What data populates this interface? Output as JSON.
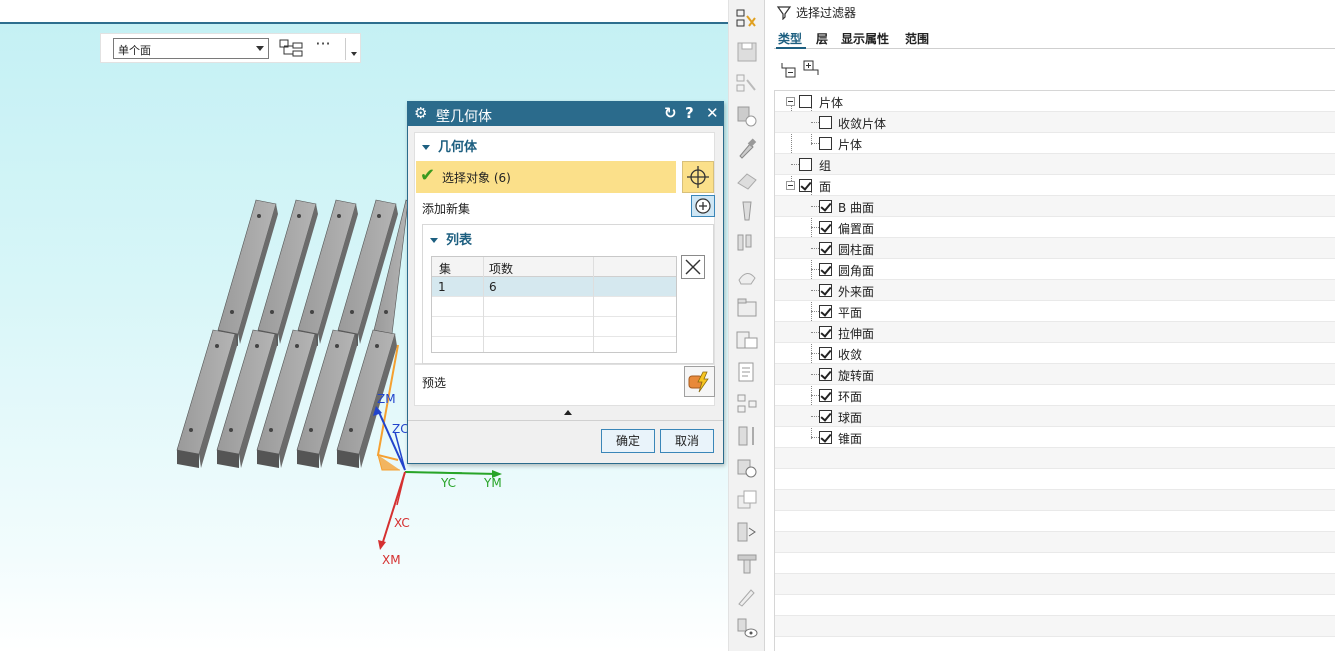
{
  "viewport": {
    "selection_filter_value": "单个面",
    "more_label": "···",
    "axis_labels": {
      "zm": "ZM",
      "zc": "ZC",
      "yc": "YC",
      "ym": "YM",
      "xc": "XC",
      "xm": "XM"
    }
  },
  "dialog": {
    "title": "壁几何体",
    "title_icons": [
      "reset-icon",
      "help-icon",
      "close-icon"
    ],
    "section_geometry": "几何体",
    "select_object": "选择对象 (6)",
    "add_new_set": "添加新集",
    "section_list": "列表",
    "table": {
      "headers": [
        "集",
        "项数",
        ""
      ],
      "rows": [
        [
          "1",
          "6",
          ""
        ],
        [
          "",
          "",
          ""
        ],
        [
          "",
          "",
          ""
        ],
        [
          "",
          "",
          ""
        ]
      ]
    },
    "preview": "预选",
    "ok": "确定",
    "cancel": "取消"
  },
  "filter_panel": {
    "title": "选择过滤器",
    "tabs": [
      "类型",
      "层",
      "显示属性",
      "范围"
    ],
    "active_tab": "类型",
    "tree": [
      {
        "label": "片体",
        "checked": false,
        "level": 0,
        "expanded": true
      },
      {
        "label": "收敛片体",
        "checked": false,
        "level": 1
      },
      {
        "label": "片体",
        "checked": false,
        "level": 1
      },
      {
        "label": "组",
        "checked": false,
        "level": 0
      },
      {
        "label": "面",
        "checked": true,
        "level": 0,
        "expanded": true
      },
      {
        "label": "B 曲面",
        "checked": true,
        "level": 1
      },
      {
        "label": "偏置面",
        "checked": true,
        "level": 1
      },
      {
        "label": "圆柱面",
        "checked": true,
        "level": 1
      },
      {
        "label": "圆角面",
        "checked": true,
        "level": 1
      },
      {
        "label": "外来面",
        "checked": true,
        "level": 1
      },
      {
        "label": "平面",
        "checked": true,
        "level": 1
      },
      {
        "label": "拉伸面",
        "checked": true,
        "level": 1
      },
      {
        "label": "收敛",
        "checked": true,
        "level": 1
      },
      {
        "label": "旋转面",
        "checked": true,
        "level": 1
      },
      {
        "label": "环面",
        "checked": true,
        "level": 1
      },
      {
        "label": "球面",
        "checked": true,
        "level": 1
      },
      {
        "label": "锥面",
        "checked": true,
        "level": 1
      }
    ]
  },
  "colors": {
    "accent": "#2b6b8c",
    "highlight": "#fbe08a",
    "viewport_top": "#c3f0f4",
    "part_gray": "#8a8a8a"
  }
}
